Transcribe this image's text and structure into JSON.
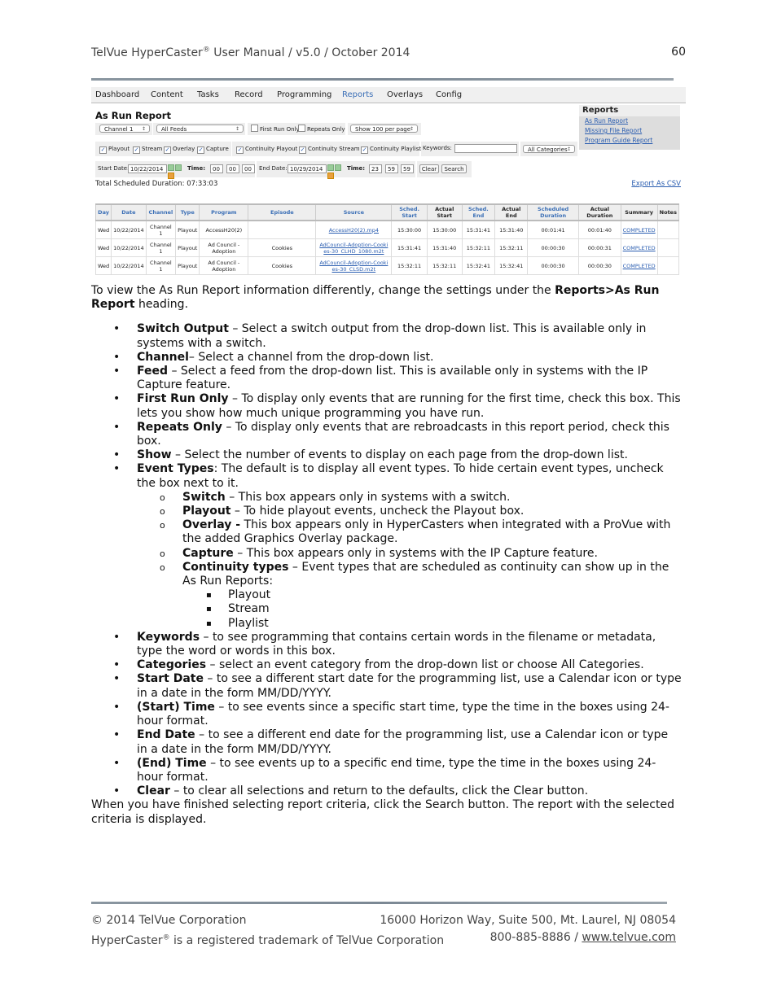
{
  "header": {
    "title_pre": "TelVue HyperCaster",
    "reg": "®",
    "title_post": " User Manual  / v5.0 / October 2014",
    "page_number": "60"
  },
  "ui": {
    "nav": [
      "Dashboard",
      "Content",
      "Tasks",
      "Record",
      "Programming",
      "Reports",
      "Overlays",
      "Config"
    ],
    "active_nav": "Reports",
    "page_title": "As Run Report",
    "channel_select": "Channel 1",
    "feed_select": "All Feeds",
    "first_run_only": "First Run Only",
    "repeats_only": "Repeats Only",
    "show_select": "Show 100 per page",
    "event_types": [
      "Playout",
      "Stream",
      "Overlay",
      "Capture"
    ],
    "continuity_types": [
      "Continuity Playout",
      "Continuity Stream",
      "Continuity Playlist"
    ],
    "keywords_label": "Keywords:",
    "keywords_value": "",
    "categories_select": "All Categories",
    "start_date_label": "Start Date:",
    "start_date": "10/22/2014",
    "time_label": "Time:",
    "start_time": [
      "00",
      "00",
      "00"
    ],
    "end_date_label": "End Date:",
    "end_date": "10/29/2014",
    "end_time": [
      "23",
      "59",
      "59"
    ],
    "clear_button": "Clear",
    "search_button": "Search",
    "total_duration": "Total Scheduled Duration: 07:33:03",
    "export_csv": "Export As CSV",
    "sidebar": {
      "heading": "Reports",
      "links": [
        "As Run Report",
        "Missing File Report",
        "Program Guide Report"
      ]
    },
    "table": {
      "columns": [
        "Day",
        "Date",
        "Channel",
        "Type",
        "Program",
        "Episode",
        "Source",
        "Sched. Start",
        "Actual Start",
        "Sched. End",
        "Actual End",
        "Scheduled Duration",
        "Actual Duration",
        "Summary",
        "Notes"
      ],
      "rows": [
        [
          "Wed",
          "10/22/2014",
          "Channel 1",
          "Playout",
          "AccessH20(2)",
          "",
          "AccessH20(2).mp4",
          "15:30:00",
          "15:30:00",
          "15:31:41",
          "15:31:40",
          "00:01:41",
          "00:01:40",
          "COMPLETED",
          ""
        ],
        [
          "Wed",
          "10/22/2014",
          "Channel 1",
          "Playout",
          "Ad Council - Adoption",
          "Cookies",
          "AdCouncil-Adoption-Cookies-30_CLHD_1080.m2t",
          "15:31:41",
          "15:31:40",
          "15:32:11",
          "15:32:11",
          "00:00:30",
          "00:00:31",
          "COMPLETED",
          ""
        ],
        [
          "Wed",
          "10/22/2014",
          "Channel 1",
          "Playout",
          "Ad Council - Adoption",
          "Cookies",
          "AdCouncil-Adoption-Cookies-30_CLSD.m2t",
          "15:32:11",
          "15:32:11",
          "15:32:41",
          "15:32:41",
          "00:00:30",
          "00:00:30",
          "COMPLETED",
          ""
        ]
      ]
    }
  },
  "intro": {
    "pre": "To view the As Run Report information differently, change the settings under the ",
    "bold": "Reports>As Run Report",
    "post": " heading."
  },
  "bullets": [
    {
      "term": "Switch Output",
      "text": " – Select a switch output from the drop-down list. This is available only in systems with a switch."
    },
    {
      "term": "Channel",
      "text": "– Select a channel from the drop-down list."
    },
    {
      "term": "Feed",
      "text": " – Select a feed from the drop-down list. This is available only in systems with the IP Capture feature."
    },
    {
      "term": "First Run Only",
      "text": " – To display only events that are running for the first time, check this box.  This lets you show how much unique programming you have run."
    },
    {
      "term": "Repeats Only",
      "text": " – To display only events that are rebroadcasts in this report period, check this box."
    },
    {
      "term": "Show",
      "text": " – Select the number of events to display on each page from the drop-down list."
    },
    {
      "term": "Event Types",
      "text": ": The default is to display all event types. To hide certain event types, uncheck the box next to it."
    }
  ],
  "sub_bullets": [
    {
      "term": "Switch",
      "text": " – This box appears only in systems with a switch."
    },
    {
      "term": "Playout",
      "text": " – To hide playout events, uncheck the Playout box."
    },
    {
      "term": "Overlay -",
      "text": " This box appears only in HyperCasters when integrated with a ProVue with the added Graphics Overlay package."
    },
    {
      "term": "Capture",
      "text": " – This box appears only in systems with the IP Capture feature."
    },
    {
      "term": "Continuity types",
      "text": " – Event types that are scheduled as continuity can show up in the As Run Reports:"
    }
  ],
  "continuity_list": [
    "Playout",
    "Stream",
    "Playlist"
  ],
  "bullets_after": [
    {
      "term": "Keywords",
      "text": " – to see programming that contains certain words in the filename or metadata, type the word or words in this box."
    },
    {
      "term": "Categories",
      "text": " – select an event category from the drop-down list or choose All Categories."
    },
    {
      "term": "Start Date",
      "text": " – to see a different start date for the programming list, use a Calendar icon or type in a date in the form MM/DD/YYYY."
    },
    {
      "term": "(Start) Time",
      "text": " – to see events since a specific start time, type the time in the boxes using 24-hour format."
    },
    {
      "term": "End Date",
      "text": " – to see a different end date for the programming list, use a Calendar icon or type in a date in the form MM/DD/YYYY."
    },
    {
      "term": "(End) Time",
      "text": " – to see events up to a specific end time, type the time in the boxes using 24-hour format."
    },
    {
      "term": "Clear",
      "text": " – to clear all selections and return to the defaults, click the Clear button."
    }
  ],
  "closing": "When you have finished selecting report criteria, click the Search button. The report with the selected criteria is displayed.",
  "footer": {
    "copyright": "© 2014 TelVue Corporation",
    "address": "16000 Horizon Way, Suite 500, Mt. Laurel, NJ 08054",
    "trademark_pre": "HyperCaster",
    "reg": "®",
    "trademark_post": " is a registered trademark of TelVue Corporation",
    "phone": "800-885-8886  / ",
    "website": "www.telvue.com"
  }
}
